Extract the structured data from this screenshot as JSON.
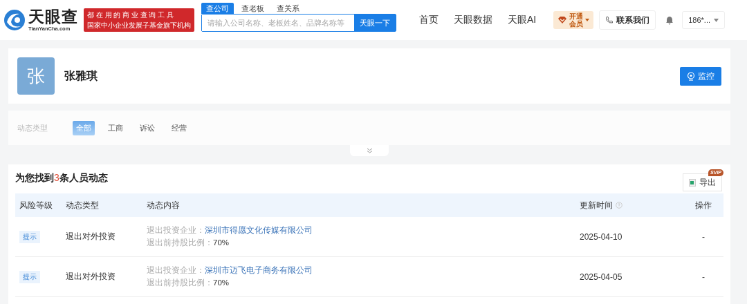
{
  "header": {
    "logo": {
      "name": "天眼查",
      "domain": "TianYanCha.com"
    },
    "slogan": [
      "都 在 用 的 商 业 查 询 工 具",
      "国家中小企业发展子基金旗下机构"
    ],
    "search_tabs": [
      {
        "label": "查公司",
        "selected": true
      },
      {
        "label": "查老板",
        "selected": false
      },
      {
        "label": "查关系",
        "selected": false
      }
    ],
    "search": {
      "placeholder": "请输入公司名称、老板姓名、品牌名称等",
      "button": "天眼一下"
    },
    "nav": [
      "首页",
      "天眼数据",
      "天眼AI"
    ],
    "vip": "开通会员",
    "contact": "联系我们",
    "user": "186*..."
  },
  "profile": {
    "avatar": "张",
    "name": "张雅琪",
    "monitor_button": "监控"
  },
  "filter": {
    "label": "动态类型",
    "options": [
      {
        "label": "全部",
        "selected": true
      },
      {
        "label": "工商",
        "selected": false
      },
      {
        "label": "诉讼",
        "selected": false
      },
      {
        "label": "经营",
        "selected": false
      }
    ]
  },
  "results": {
    "title": {
      "prefix": "为您找到",
      "count": "3",
      "suffix": "条人员动态"
    },
    "export": {
      "label": "导出",
      "badge": "SVIP"
    },
    "table": {
      "columns": [
        {
          "label": "风险等级",
          "help": false
        },
        {
          "label": "动态类型",
          "help": false
        },
        {
          "label": "动态内容",
          "help": false
        },
        {
          "label": "更新时间",
          "help": true
        },
        {
          "label": "操作",
          "help": false
        }
      ],
      "rows": [
        {
          "risk": "提示",
          "type": "退出对外投资",
          "content": [
            {
              "kind": "link",
              "label": "退出投资企业：",
              "value": "深圳市得愿文化传媒有限公司"
            },
            {
              "kind": "text",
              "label": "退出前持股比例：",
              "value": "70%"
            }
          ],
          "date": "2025-04-10",
          "action": "-"
        },
        {
          "risk": "提示",
          "type": "退出对外投资",
          "content": [
            {
              "kind": "link",
              "label": "退出投资企业：",
              "value": "深圳市迈飞电子商务有限公司"
            },
            {
              "kind": "text",
              "label": "退出前持股比例：",
              "value": "70%"
            }
          ],
          "date": "2025-04-05",
          "action": "-"
        }
      ]
    }
  }
}
